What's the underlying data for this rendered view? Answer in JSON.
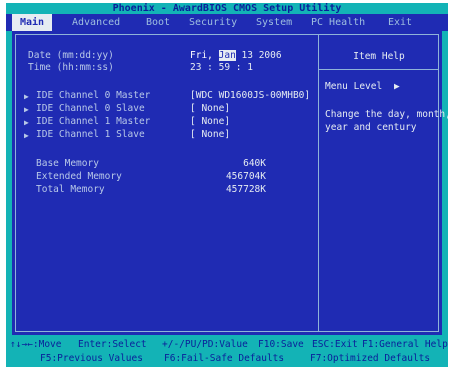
{
  "title": "Phoenix - AwardBIOS CMOS Setup Utility",
  "menu": {
    "main": "Main",
    "advanced": "Advanced",
    "boot": "Boot",
    "security": "Security",
    "system": "System",
    "pc_health": "PC Health",
    "exit": "Exit"
  },
  "settings": {
    "date_label": "Date (mm:dd:yy)",
    "date_day": "Fri,",
    "date_month": "Jan",
    "date_rest": "13 2006",
    "time_label": "Time (hh:mm:ss)",
    "time_value": "23 : 59 :  1",
    "ide0m_label": "IDE Channel 0 Master",
    "ide0m_value": "[WDC WD1600JS-00MHB0]",
    "ide0s_label": "IDE Channel 0 Slave",
    "ide0s_value": "[ None]",
    "ide1m_label": "IDE Channel 1 Master",
    "ide1m_value": "[ None]",
    "ide1s_label": "IDE Channel 1 Slave",
    "ide1s_value": "[ None]",
    "base_label": "Base Memory",
    "base_value": "640K",
    "ext_label": "Extended Memory",
    "ext_value": "456704K",
    "total_label": "Total Memory",
    "total_value": "457728K"
  },
  "help": {
    "title": "Item Help",
    "menu_level": "Menu Level",
    "menu_level_arrow": "▶",
    "line1": "Change the day, month,",
    "line2": "year and century"
  },
  "footer": {
    "k1": "↑↓→←:Move",
    "k2": "Enter:Select",
    "k3": "+/-/PU/PD:Value",
    "k4": "F10:Save",
    "k5": "ESC:Exit",
    "k6": "F1:General Help",
    "k7": "F5:Previous Values",
    "k8": "F6:Fail-Safe Defaults",
    "k9": "F7:Optimized Defaults"
  },
  "colors": {
    "background_cyan": "#13b3b6",
    "panel_blue": "#1f2bb3",
    "text_light": "#e6ecf2",
    "footer_text": "#0a1f9a"
  }
}
